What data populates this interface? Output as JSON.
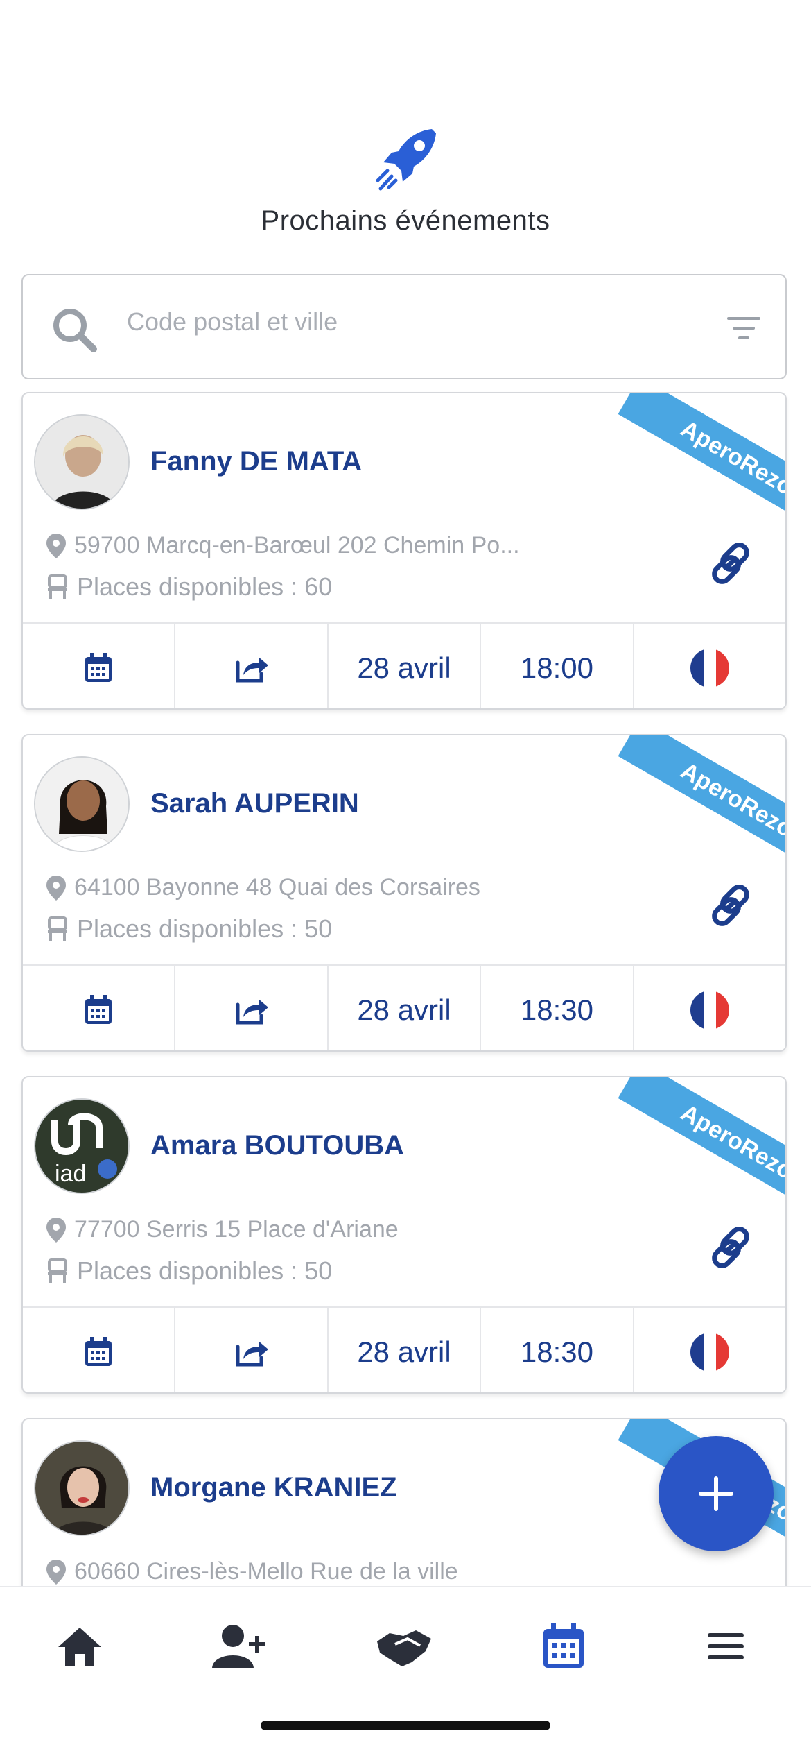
{
  "header": {
    "title": "Prochains événements",
    "icon": "rocket-icon"
  },
  "search": {
    "placeholder": "Code postal et ville"
  },
  "events": [
    {
      "name": "Fanny DE MATA",
      "ribbon": "AperoRezo",
      "address": "59700 Marcq-en-Barœul 202 Chemin Po...",
      "places": "Places disponibles : 60",
      "date": "28 avril",
      "time": "18:00"
    },
    {
      "name": "Sarah AUPERIN",
      "ribbon": "AperoRezo",
      "address": "64100 Bayonne 48 Quai des Corsaires",
      "places": "Places disponibles : 50",
      "date": "28 avril",
      "time": "18:30"
    },
    {
      "name": "Amara BOUTOUBA",
      "ribbon": "AperoRezo",
      "address": "77700 Serris 15 Place d'Ariane",
      "places": "Places disponibles : 50",
      "date": "28 avril",
      "time": "18:30"
    },
    {
      "name": "Morgane KRANIEZ",
      "ribbon": "AperoRezo",
      "address": "60660 Cires-lès-Mello Rue de la ville",
      "places": "",
      "date": "",
      "time": ""
    }
  ],
  "avatar_logo_text": "iad",
  "colors": {
    "primary": "#1c3d8c",
    "accent": "#2a55c6",
    "ribbon": "#4aa6e2",
    "muted": "#a2a6ad"
  },
  "tabbar": [
    {
      "name": "home",
      "icon": "home-icon"
    },
    {
      "name": "add-user",
      "icon": "add-user-icon"
    },
    {
      "name": "handshake",
      "icon": "handshake-icon"
    },
    {
      "name": "calendar",
      "icon": "calendar-icon",
      "active": true
    },
    {
      "name": "menu",
      "icon": "menu-icon"
    }
  ]
}
